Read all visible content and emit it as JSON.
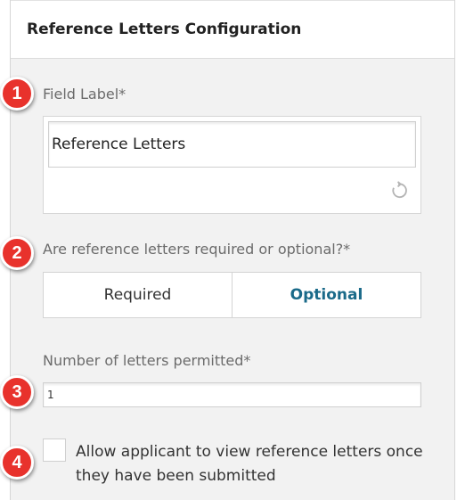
{
  "header": {
    "title": "Reference Letters Configuration"
  },
  "field_label": {
    "label": "Field Label*",
    "value": "Reference Letters",
    "reset_icon": "undo-icon"
  },
  "requirement": {
    "question": "Are reference letters required or optional?*",
    "options": [
      "Required",
      "Optional"
    ],
    "selected": "Optional"
  },
  "letters_count": {
    "label": "Number of letters permitted*",
    "value": "1"
  },
  "view_permission": {
    "checked": false,
    "label": "Allow applicant to view reference letters once they have been submitted"
  },
  "badges": [
    "1",
    "2",
    "3",
    "4"
  ],
  "colors": {
    "badge": "#e8322c",
    "accent": "#1a6a89",
    "panel_bg": "#f2f2f2"
  }
}
